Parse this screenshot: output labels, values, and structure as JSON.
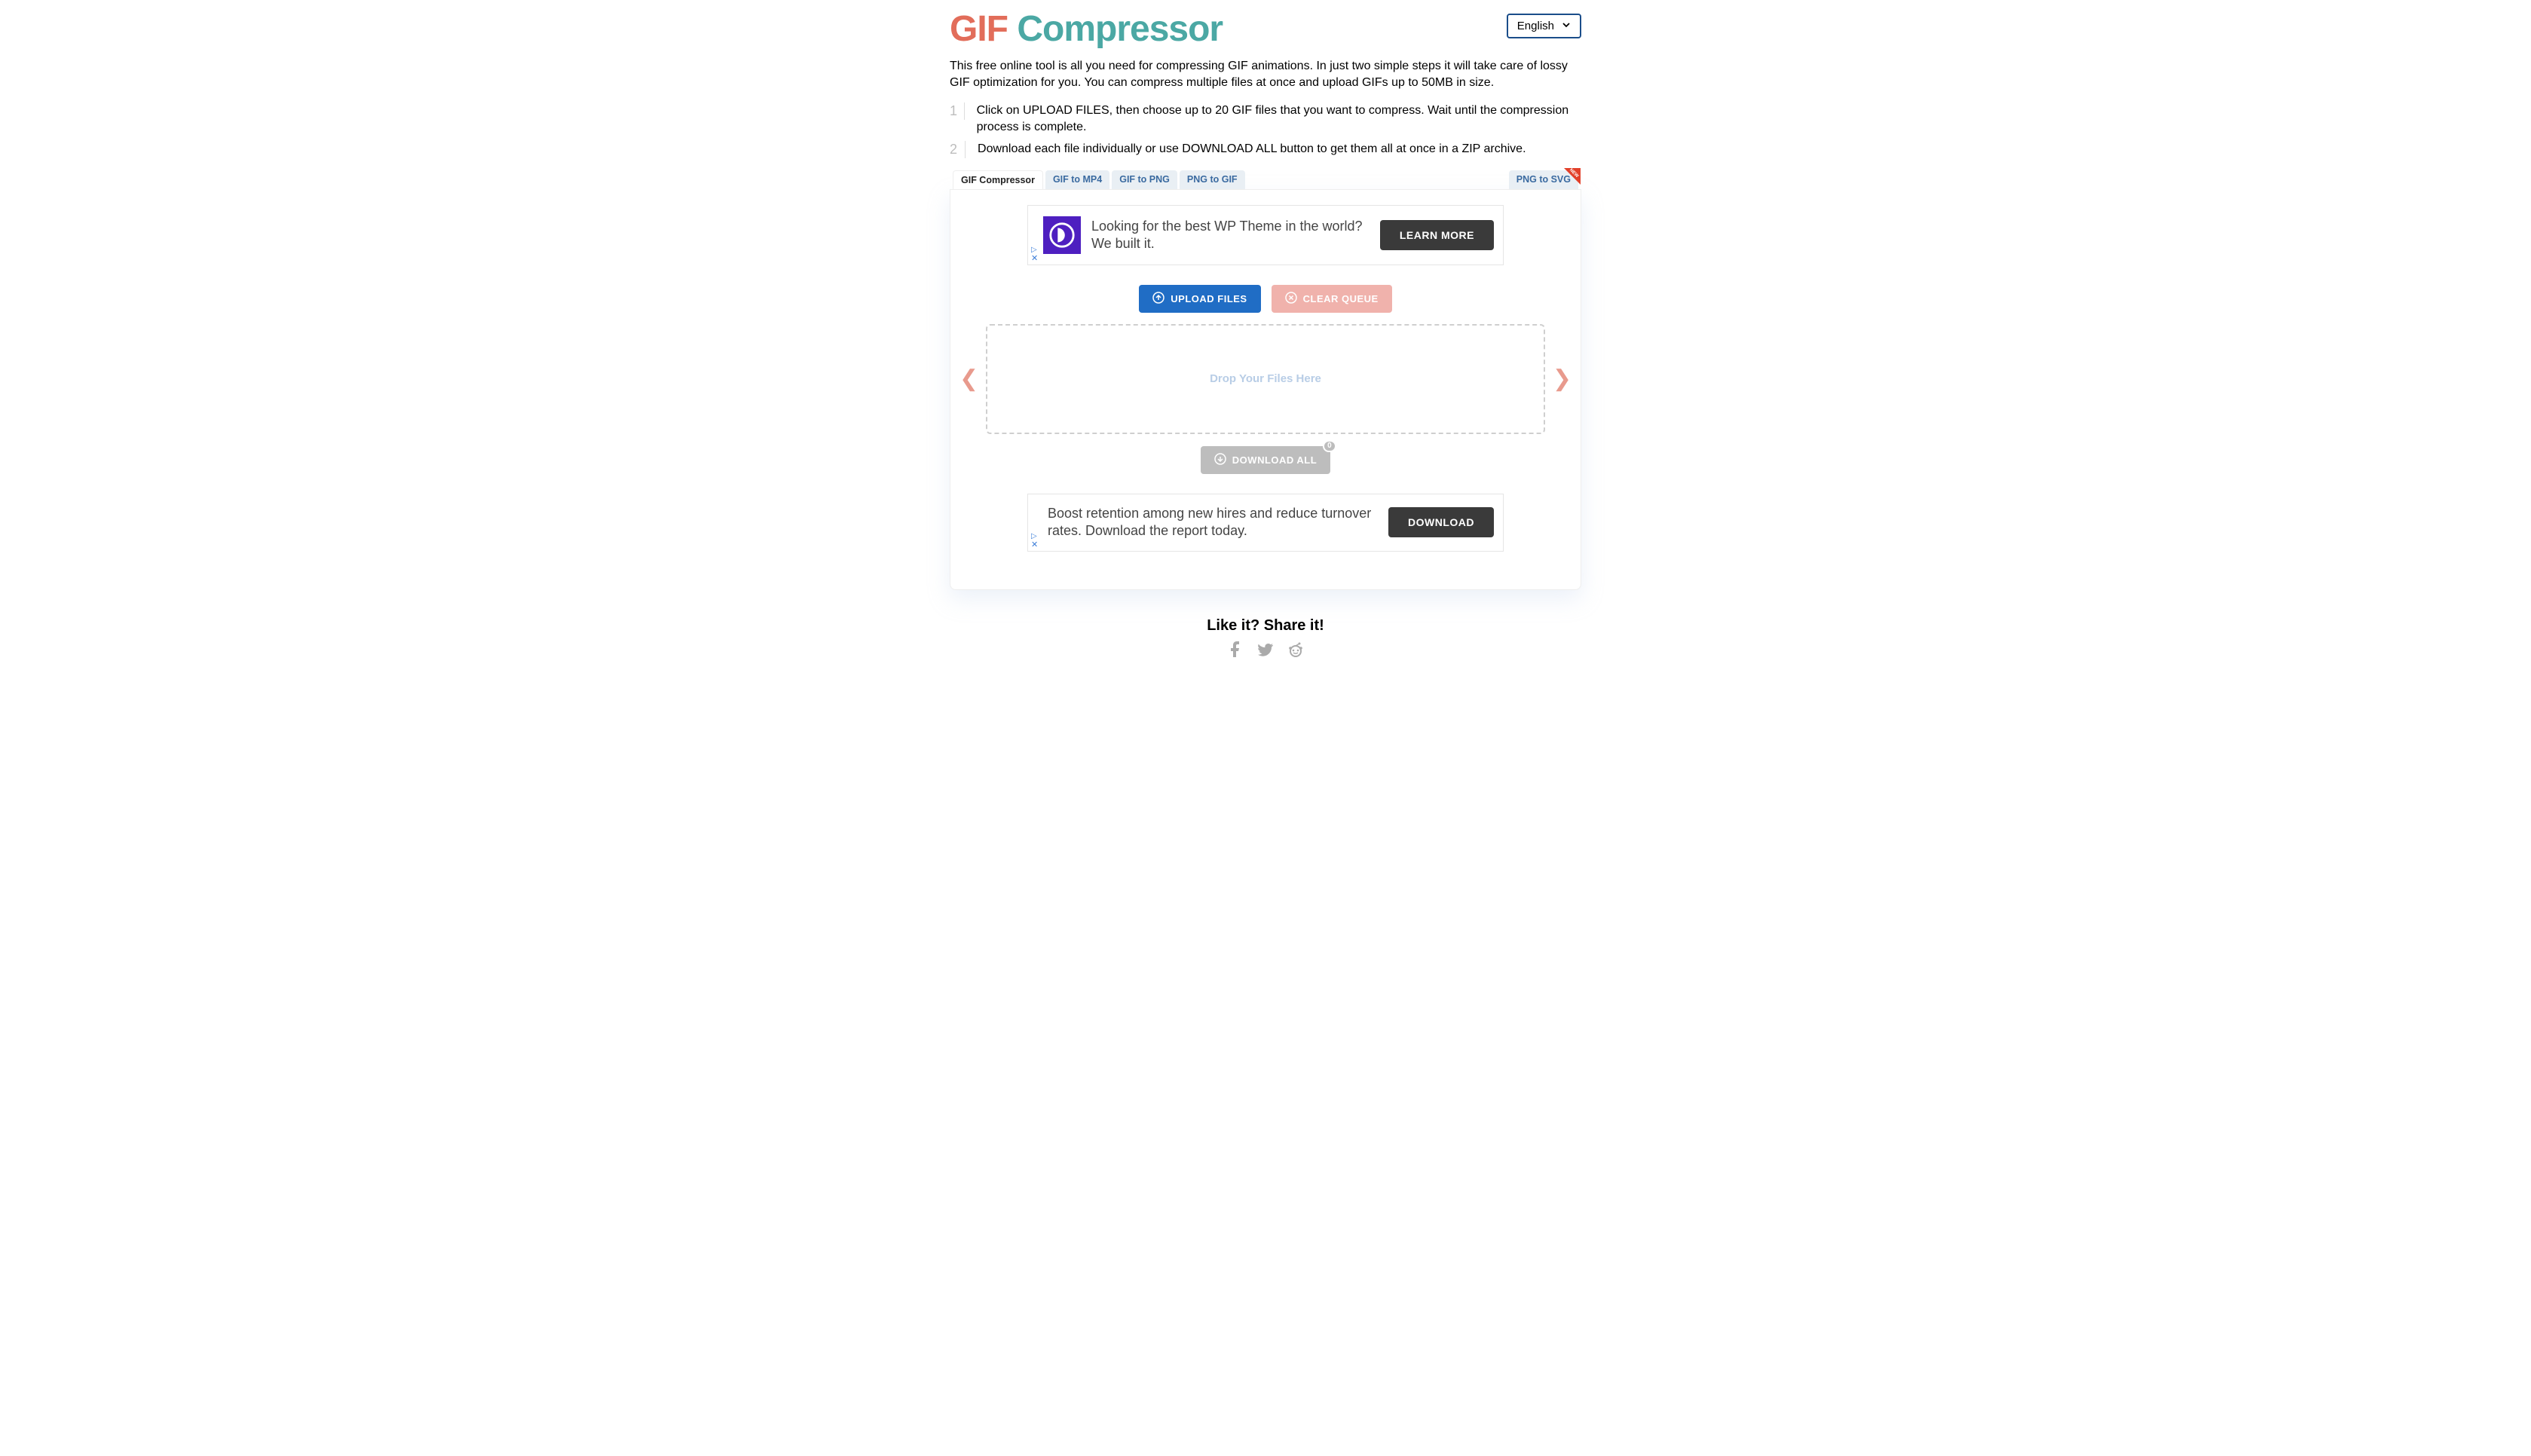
{
  "logo": {
    "part1": "GIF",
    "part2": "Compressor"
  },
  "language": {
    "selected": "English"
  },
  "intro": "This free online tool is all you need for compressing GIF animations. In just two simple steps it will take care of lossy GIF optimization for you. You can compress multiple files at once and upload GIFs up to 50MB in size.",
  "steps": [
    {
      "num": "1",
      "text": "Click on UPLOAD FILES, then choose up to 20 GIF files that you want to compress. Wait until the compression process is complete."
    },
    {
      "num": "2",
      "text": "Download each file individually or use DOWNLOAD ALL button to get them all at once in a ZIP archive."
    }
  ],
  "tabs": {
    "left": [
      {
        "label": "GIF Compressor",
        "active": true
      },
      {
        "label": "GIF to MP4",
        "active": false
      },
      {
        "label": "GIF to PNG",
        "active": false
      },
      {
        "label": "PNG to GIF",
        "active": false
      }
    ],
    "right": {
      "label": "PNG to SVG",
      "badge": "NEW"
    }
  },
  "ad1": {
    "text": "Looking for the best WP Theme in the world? We built it.",
    "cta": "LEARN MORE"
  },
  "buttons": {
    "upload": "UPLOAD FILES",
    "clear": "CLEAR QUEUE",
    "download": "DOWNLOAD ALL",
    "download_count": "0"
  },
  "dropzone": "Drop Your Files Here",
  "ad2": {
    "text": "Boost retention among new hires and reduce turnover rates. Download the report today.",
    "cta": "DOWNLOAD"
  },
  "share": {
    "title": "Like it? Share it!"
  }
}
